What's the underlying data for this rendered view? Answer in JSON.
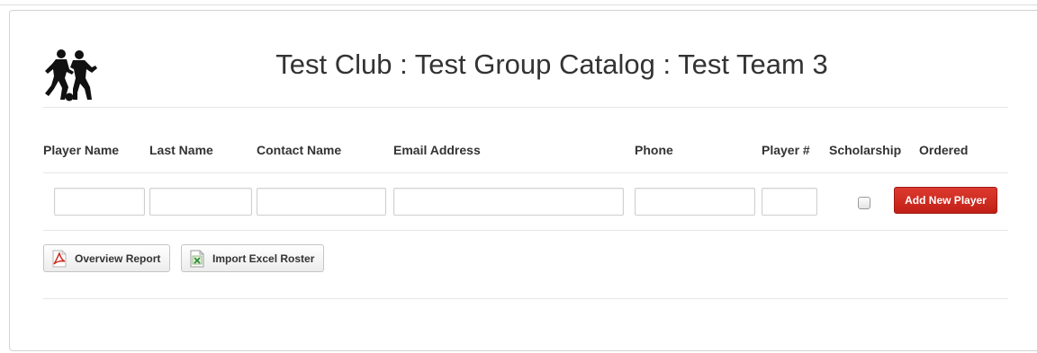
{
  "header": {
    "title": "Test Club : Test Group Catalog : Test Team 3",
    "logo_icon": "soccer-players-icon"
  },
  "columns": [
    {
      "key": "player_name",
      "label": "Player Name"
    },
    {
      "key": "last_name",
      "label": "Last Name"
    },
    {
      "key": "contact_name",
      "label": "Contact Name"
    },
    {
      "key": "email",
      "label": "Email Address"
    },
    {
      "key": "phone",
      "label": "Phone"
    },
    {
      "key": "player_number",
      "label": "Player #"
    },
    {
      "key": "scholarship",
      "label": "Scholarship"
    },
    {
      "key": "ordered",
      "label": "Ordered"
    }
  ],
  "new_player": {
    "player_name": "",
    "last_name": "",
    "contact_name": "",
    "email": "",
    "phone": "",
    "player_number": "",
    "scholarship": false,
    "add_label": "Add New Player"
  },
  "toolbar": {
    "overview_label": "Overview Report",
    "overview_icon": "pdf-icon",
    "import_label": "Import Excel Roster",
    "import_icon": "excel-icon"
  },
  "colors": {
    "accent_red": "#c21f16",
    "border": "#d2d2d2"
  }
}
